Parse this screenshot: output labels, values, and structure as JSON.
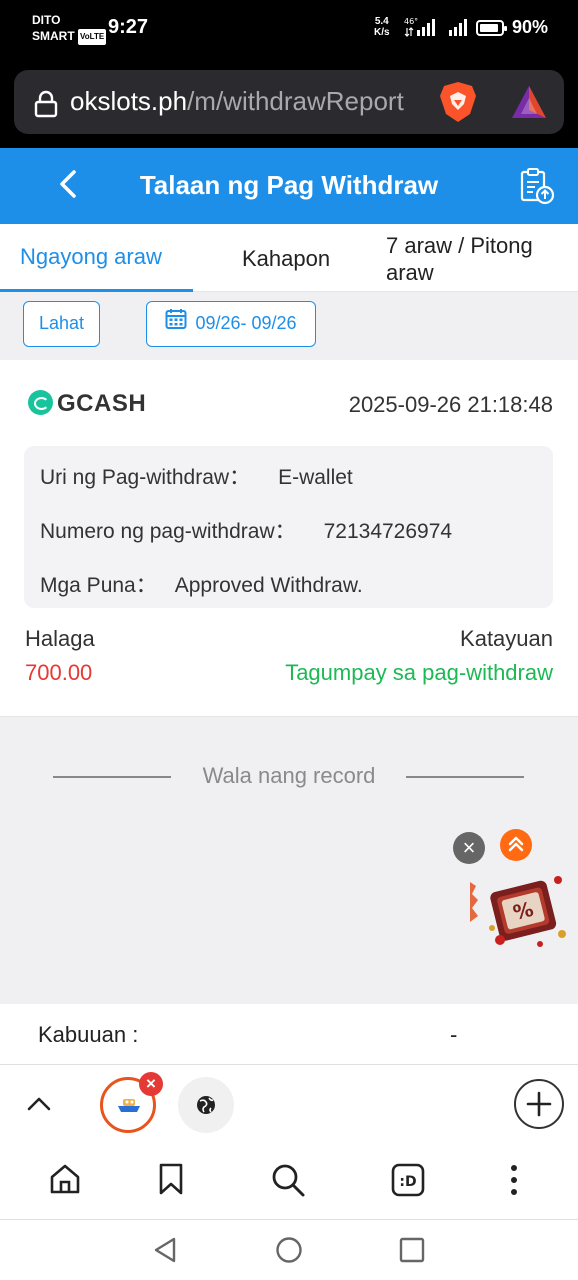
{
  "status_bar": {
    "carrier_line1": "DITO",
    "carrier_line2": "SMART",
    "volte": "VoLTE",
    "time": "9:27",
    "net_speed_value": "5.4",
    "net_speed_unit": "K/s",
    "net_type": "46°",
    "battery_percent": "90%",
    "battery_level": 0.9
  },
  "browser": {
    "url_domain": "okslots.ph",
    "url_path": "/m/withdrawReport"
  },
  "header": {
    "title": "Talaan ng Pag Withdraw"
  },
  "tabs": [
    {
      "label": "Ngayong araw",
      "active": true
    },
    {
      "label": "Kahapon",
      "active": false
    },
    {
      "label": "7 araw / Pitong araw",
      "active": false
    }
  ],
  "filters": {
    "type_label": "Lahat",
    "date_range": "09/26- 09/26"
  },
  "record": {
    "provider": "GCASH",
    "datetime": "2025-09-26 21:18:48",
    "details": [
      {
        "label": "Uri ng Pag-withdraw：",
        "value": "E-wallet"
      },
      {
        "label": "Numero ng pag-withdraw：",
        "value": "72134726974"
      },
      {
        "label": "Mga Puna：",
        "value": "Approved Withdraw."
      }
    ],
    "amount_label": "Halaga",
    "amount": "700.00",
    "status_label": "Katayuan",
    "status": "Tagumpay sa pag-withdraw"
  },
  "no_more": "Wala nang record",
  "summary": {
    "label": "Kabuuan :",
    "value": "-"
  },
  "colors": {
    "primary": "#1e8fe8",
    "amount": "#e53935",
    "success": "#1db954"
  }
}
